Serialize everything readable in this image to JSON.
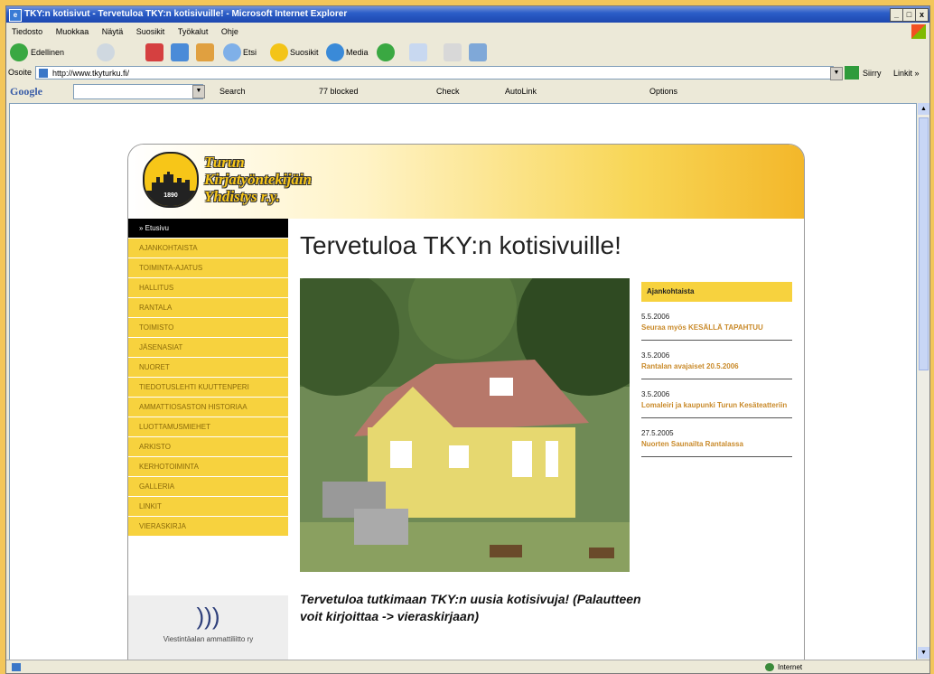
{
  "window": {
    "title": "TKY:n kotisivut - Tervetuloa TKY:n kotisivuille! - Microsoft Internet Explorer",
    "controls": [
      "_",
      "□",
      "x"
    ]
  },
  "menu": [
    "Tiedosto",
    "Muokkaa",
    "Näytä",
    "Suosikit",
    "Työkalut",
    "Ohje"
  ],
  "toolbar": {
    "back": "Edellinen",
    "search": "Etsi",
    "favorites": "Suosikit",
    "media": "Media"
  },
  "address": {
    "label": "Osoite",
    "url": "http://www.tkyturku.fi/",
    "go": "Siirry",
    "links": "Linkit »"
  },
  "google": {
    "logo": "Google",
    "search": "Search",
    "blocked": "77 blocked",
    "check": "Check",
    "autolink": "AutoLink",
    "options": "Options"
  },
  "site": {
    "brand_line1": "Turun",
    "brand_line2": "Kirjatyöntekijäin",
    "brand_line3": "Yhdistys r.y.",
    "logo_year": "1890",
    "nav": [
      {
        "label": "» Etusivu",
        "active": true
      },
      {
        "label": "AJANKOHTAISTA",
        "active": false
      },
      {
        "label": "TOIMINTA-AJATUS",
        "active": false
      },
      {
        "label": "HALLITUS",
        "active": false
      },
      {
        "label": "RANTALA",
        "active": false
      },
      {
        "label": "TOIMISTO",
        "active": false
      },
      {
        "label": "JÄSENASIAT",
        "active": false
      },
      {
        "label": "NUORET",
        "active": false
      },
      {
        "label": "TIEDOTUSLEHTI KUUTTENPERI",
        "active": false
      },
      {
        "label": "AMMATTIOSASTON HISTORIAA",
        "active": false
      },
      {
        "label": "LUOTTAMUSMIEHET",
        "active": false
      },
      {
        "label": "ARKISTO",
        "active": false
      },
      {
        "label": "KERHOTOIMINTA",
        "active": false
      },
      {
        "label": "GALLERIA",
        "active": false
      },
      {
        "label": "LINKIT",
        "active": false
      },
      {
        "label": "VIERASKIRJA",
        "active": false
      }
    ],
    "partner": "Viestintäalan ammattiliitto ry",
    "title": "Tervetuloa TKY:n kotisivuille!",
    "news_heading": "Ajankohtaista",
    "news": [
      {
        "date": "5.5.2006",
        "text": "Seuraa myös KESÄLLÄ TAPAHTUU"
      },
      {
        "date": "3.5.2006",
        "text": "Rantalan avajaiset 20.5.2006"
      },
      {
        "date": "3.5.2006",
        "text": "Lomaleiri ja kaupunki Turun Kesäteatteriin"
      },
      {
        "date": "27.5.2005",
        "text": "Nuorten Saunailta Rantalassa"
      }
    ],
    "welcome": "Tervetuloa tutkimaan TKY:n uusia kotisivuja! (Palautteen voit kirjoittaa -> vieraskirjaan)"
  },
  "status": {
    "zone": "Internet"
  }
}
